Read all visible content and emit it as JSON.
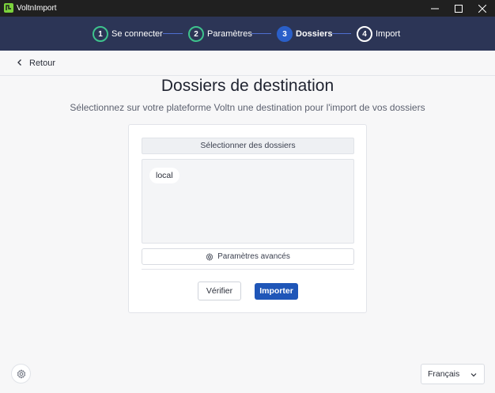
{
  "window": {
    "title": "VoltnImport"
  },
  "steps": [
    {
      "number": "1",
      "label": "Se connecter",
      "state": "done"
    },
    {
      "number": "2",
      "label": "Paramètres",
      "state": "done"
    },
    {
      "number": "3",
      "label": "Dossiers",
      "state": "active"
    },
    {
      "number": "4",
      "label": "Import",
      "state": "todo"
    }
  ],
  "nav": {
    "back_label": "Retour"
  },
  "page": {
    "title": "Dossiers de destination",
    "subtitle": "Sélectionnez sur votre plateforme Voltn une destination pour l'import de vos dossiers"
  },
  "card": {
    "select_header": "Sélectionner des dossiers",
    "folders": [
      "local"
    ],
    "advanced_label": "Paramètres avancés",
    "verify_label": "Vérifier",
    "import_label": "Importer"
  },
  "footer": {
    "language": "Français"
  },
  "colors": {
    "stepper_bg": "#2c3556",
    "step_done": "#3ec38d",
    "step_active": "#2a5fc9",
    "primary_button": "#1f56b8",
    "logo": "#7bd23c"
  }
}
